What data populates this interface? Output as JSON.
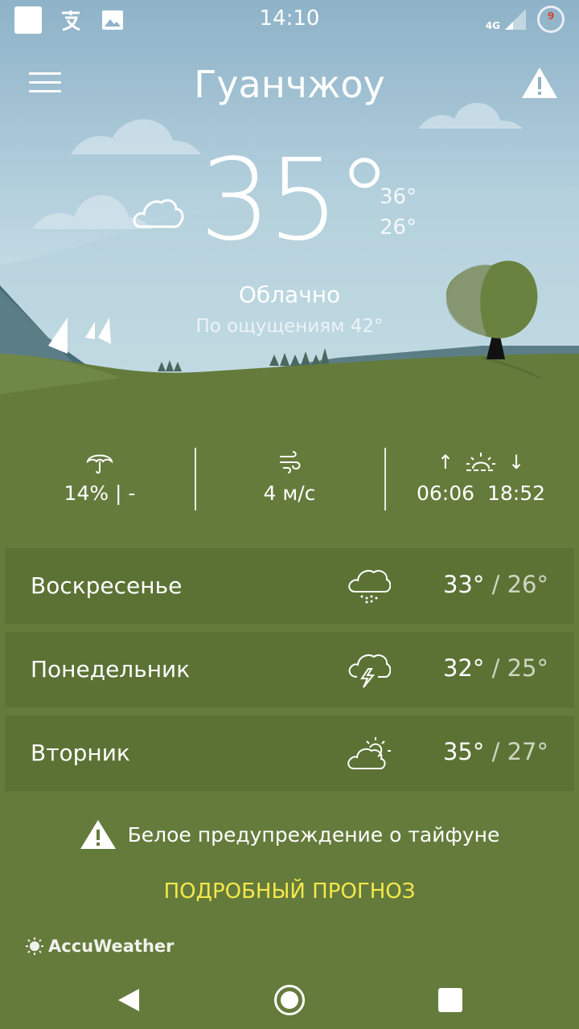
{
  "status_bar": {
    "time": "14:10",
    "network": "4G",
    "battery": "9",
    "icons": [
      "notification-square-icon",
      "translate-icon",
      "image-icon"
    ]
  },
  "header": {
    "city": "Гуанчжоу",
    "menu_icon": "hamburger-menu-icon",
    "warning_icon": "warning-triangle-icon"
  },
  "current": {
    "icon": "cloud-icon",
    "temp": "35°",
    "high": "36°",
    "low": "26°",
    "condition": "Облачно",
    "feels_like": "По ощущениям 42°"
  },
  "stats": {
    "precip": "14% | -",
    "wind": "4 м/с",
    "sunrise": "06:06",
    "sunset": "18:52",
    "sunrise_arrow": "↑",
    "sunset_arrow": "↓"
  },
  "forecast": [
    {
      "day": "Воскресенье",
      "icon": "rain-cloud-icon",
      "high": "33°",
      "sep": "/",
      "low": "26°"
    },
    {
      "day": "Понедельник",
      "icon": "thunderstorm-icon",
      "high": "32°",
      "sep": "/",
      "low": "25°"
    },
    {
      "day": "Вторник",
      "icon": "partly-cloudy-icon",
      "high": "35°",
      "sep": "/",
      "low": "27°"
    }
  ],
  "alert": {
    "text": "Белое предупреждение о тайфуне"
  },
  "detail_link": "ПОДРОБНЫЙ ПРОГНОЗ",
  "brand": "AccuWeather",
  "colors": {
    "grass": "#657b3c",
    "row": "#5b7234",
    "link": "#f4e84a",
    "sky_top": "#8fb3c9",
    "sky_bottom": "#cfe3ea"
  }
}
